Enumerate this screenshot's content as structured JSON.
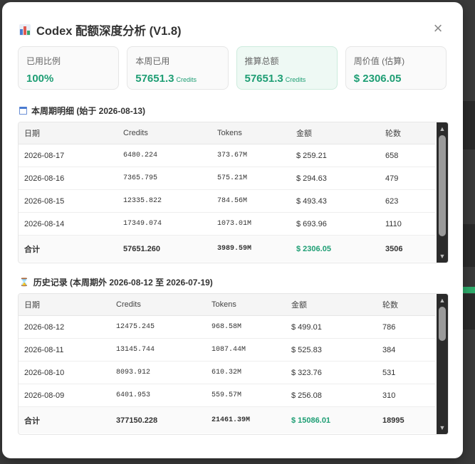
{
  "modal": {
    "title": "Codex 配额深度分析 (V1.8)",
    "close_symbol": "×"
  },
  "stats": [
    {
      "label": "已用比例",
      "value": "100%",
      "unit": ""
    },
    {
      "label": "本周已用",
      "value": "57651.3",
      "unit": "Credits"
    },
    {
      "label": "推算总额",
      "value": "57651.3",
      "unit": "Credits"
    },
    {
      "label": "周价值 (估算)",
      "value": "$ 2306.05",
      "unit": ""
    }
  ],
  "current_week": {
    "title": "本周期明细 (始于 2026-08-13)",
    "headers": [
      "日期",
      "Credits",
      "Tokens",
      "金额",
      "轮数"
    ],
    "rows": [
      [
        "2026-08-17",
        "6480.224",
        "373.67M",
        "$ 259.21",
        "658"
      ],
      [
        "2026-08-16",
        "7365.795",
        "575.21M",
        "$ 294.63",
        "479"
      ],
      [
        "2026-08-15",
        "12335.822",
        "784.56M",
        "$ 493.43",
        "623"
      ],
      [
        "2026-08-14",
        "17349.074",
        "1073.01M",
        "$ 693.96",
        "1110"
      ]
    ],
    "total": [
      "合计",
      "57651.260",
      "3989.59M",
      "$ 2306.05",
      "3506"
    ]
  },
  "history": {
    "title": "历史记录 (本周期外 2026-08-12 至 2026-07-19)",
    "headers": [
      "日期",
      "Credits",
      "Tokens",
      "金额",
      "轮数"
    ],
    "rows": [
      [
        "2026-08-12",
        "12475.245",
        "968.58M",
        "$ 499.01",
        "786"
      ],
      [
        "2026-08-11",
        "13145.744",
        "1087.44M",
        "$ 525.83",
        "384"
      ],
      [
        "2026-08-10",
        "8093.912",
        "610.32M",
        "$ 323.76",
        "531"
      ],
      [
        "2026-08-09",
        "6401.953",
        "559.57M",
        "$ 256.08",
        "310"
      ]
    ],
    "total": [
      "合计",
      "377150.228",
      "21461.39M",
      "$ 15086.01",
      "18995"
    ]
  },
  "colors": {
    "accent": "#1e9e74",
    "highlight_bg": "#eef9f4"
  },
  "icons": {
    "title_icon": "bar-chart-icon",
    "current_week_icon": "calendar-icon",
    "history_icon": "hourglass-icon"
  }
}
